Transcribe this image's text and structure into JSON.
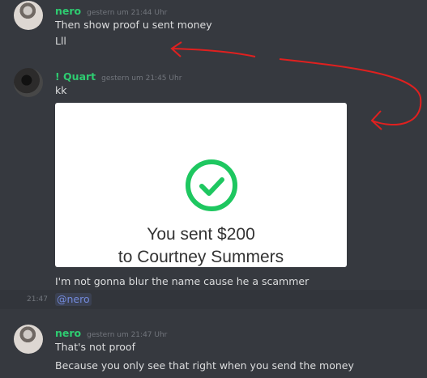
{
  "messages": [
    {
      "username": "nero",
      "timestamp": "gestern um 21:44 Uhr",
      "lines": [
        "Then show proof u sent money",
        "Lll"
      ]
    },
    {
      "username": "! Quart",
      "timestamp": "gestern um 21:45 Uhr",
      "lines": [
        "kk",
        "I'm not gonna blur the name cause he a scammer"
      ],
      "attachment": {
        "line1": "You sent $200",
        "line2": "to Courtney Summers",
        "icon": "check-circle-icon",
        "accent_color": "#1ec760"
      },
      "followup_time": "21:47",
      "mention": "@nero"
    },
    {
      "username": "nero",
      "timestamp": "gestern um 21:47 Uhr",
      "lines": [
        "That's not proof",
        "Because you only see that right when you send the money"
      ]
    }
  ],
  "colors": {
    "background": "#36393f",
    "username": "#2ecc71",
    "text": "#dcddde",
    "muted": "#72767d",
    "mention": "#7289da",
    "annotation": "#e0201f"
  }
}
